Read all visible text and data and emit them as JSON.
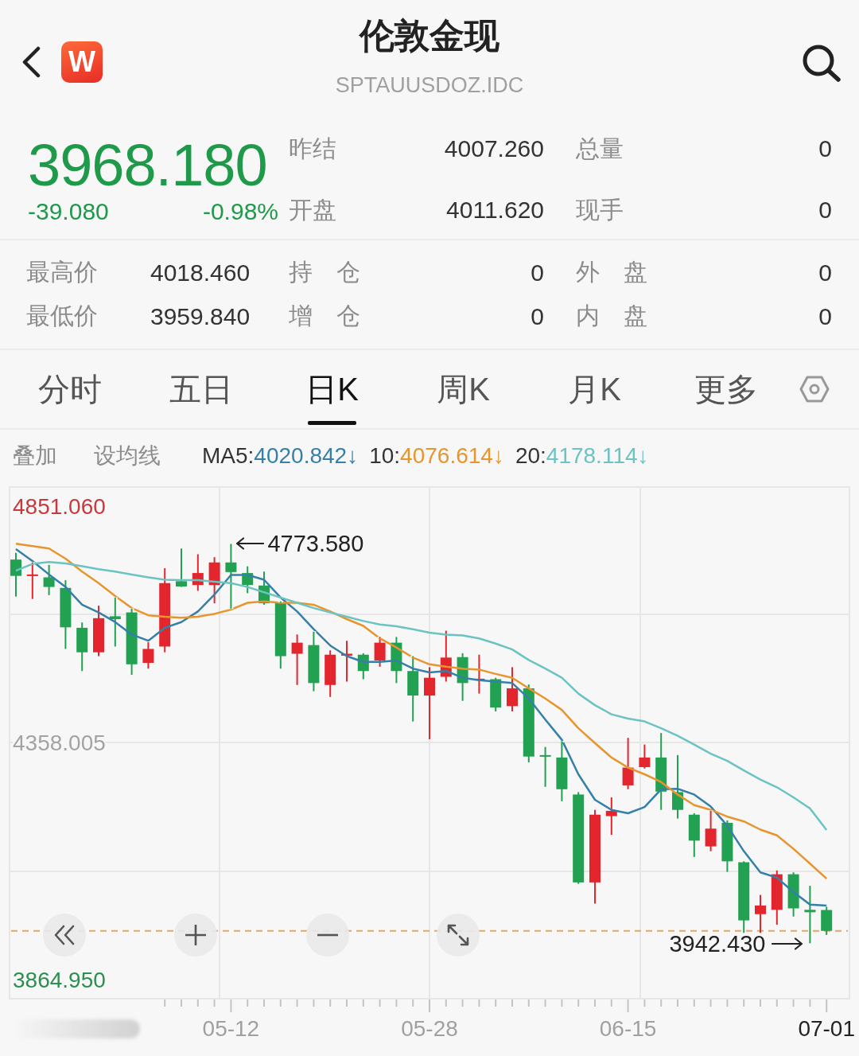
{
  "header": {
    "logo_text": "W",
    "title": "伦敦金现",
    "subtitle": "SPTAUUSDOZ.IDC"
  },
  "quote": {
    "price": "3968.180",
    "change": "-39.080",
    "change_percent": "-0.98%",
    "falling": true,
    "fields": [
      {
        "label": "昨结",
        "value": "4007.260"
      },
      {
        "label": "总量",
        "value": "0"
      },
      {
        "label": "开盘",
        "value": "4011.620"
      },
      {
        "label": "现手",
        "value": "0"
      }
    ]
  },
  "stats": [
    {
      "label": "最高价",
      "value": "4018.460"
    },
    {
      "label": "持　仓",
      "value": "0"
    },
    {
      "label": "外　盘",
      "value": "0"
    },
    {
      "label": "最低价",
      "value": "3959.840"
    },
    {
      "label": "增　仓",
      "value": "0"
    },
    {
      "label": "内　盘",
      "value": "0"
    }
  ],
  "tabs": [
    {
      "label": "分时",
      "selected": false
    },
    {
      "label": "五日",
      "selected": false
    },
    {
      "label": "日K",
      "selected": true
    },
    {
      "label": "周K",
      "selected": false
    },
    {
      "label": "月K",
      "selected": false
    },
    {
      "label": "更多",
      "selected": false
    }
  ],
  "indicator_bar": {
    "buttons": [
      "叠加",
      "设均线"
    ],
    "moving_averages": [
      {
        "value": "4020.842↓"
      },
      {
        "value": "4076.614↓"
      },
      {
        "value": "4178.114↓"
      }
    ]
  },
  "chart": {
    "last_date_highlighted": true,
    "chart_data": {
      "type": "candlestick",
      "categories": [
        null,
        null,
        null,
        null,
        null,
        null,
        null,
        null,
        null,
        null,
        null,
        null,
        null,
        "05-12",
        null,
        null,
        null,
        null,
        null,
        null,
        null,
        null,
        null,
        null,
        null,
        "05-28",
        null,
        null,
        null,
        null,
        null,
        null,
        null,
        null,
        null,
        null,
        null,
        "06-15",
        null,
        null,
        null,
        null,
        null,
        null,
        null,
        null,
        null,
        null,
        null,
        "07-01"
      ],
      "ohlc": [
        [
          4741,
          4755,
          4664,
          4707
        ],
        [
          4707,
          4735,
          4659,
          4710
        ],
        [
          4704,
          4730,
          4667,
          4684
        ],
        [
          4682,
          4698,
          4555,
          4600
        ],
        [
          4599,
          4610,
          4509,
          4548
        ],
        [
          4548,
          4645,
          4540,
          4619
        ],
        [
          4623,
          4662,
          4560,
          4617
        ],
        [
          4631,
          4639,
          4501,
          4523
        ],
        [
          4526,
          4569,
          4514,
          4555
        ],
        [
          4560,
          4723,
          4548,
          4692
        ],
        [
          4696,
          4764,
          4684,
          4685
        ],
        [
          4688,
          4752,
          4676,
          4713
        ],
        [
          4688,
          4746,
          4650,
          4735
        ],
        [
          4735,
          4773.58,
          4639,
          4715
        ],
        [
          4713,
          4727,
          4671,
          4688
        ],
        [
          4687,
          4716,
          4647,
          4650
        ],
        [
          4651,
          4654,
          4514,
          4540
        ],
        [
          4545,
          4585,
          4480,
          4568
        ],
        [
          4563,
          4591,
          4467,
          4484
        ],
        [
          4480,
          4552,
          4455,
          4543
        ],
        [
          4541,
          4572,
          4487,
          4545
        ],
        [
          4543,
          4546,
          4492,
          4509
        ],
        [
          4531,
          4580,
          4518,
          4568
        ],
        [
          4568,
          4580,
          4484,
          4509
        ],
        [
          4509,
          4540,
          4404,
          4458
        ],
        [
          4458,
          4517,
          4367,
          4495
        ],
        [
          4497,
          4593,
          4487,
          4537
        ],
        [
          4538,
          4546,
          4447,
          4484
        ],
        [
          4490,
          4543,
          4462,
          4493
        ],
        [
          4492,
          4495,
          4425,
          4433
        ],
        [
          4436,
          4517,
          4425,
          4473
        ],
        [
          4473,
          4481,
          4319,
          4331
        ],
        [
          4334,
          4351,
          4268,
          4331
        ],
        [
          4329,
          4363,
          4238,
          4263
        ],
        [
          4252,
          4257,
          4066,
          4069
        ],
        [
          4069,
          4220,
          4025,
          4210
        ],
        [
          4207,
          4246,
          4168,
          4218
        ],
        [
          4271,
          4370,
          4263,
          4308
        ],
        [
          4309,
          4356,
          4306,
          4329
        ],
        [
          4329,
          4380,
          4220,
          4258
        ],
        [
          4257,
          4334,
          4202,
          4220
        ],
        [
          4210,
          4213,
          4122,
          4156
        ],
        [
          4144,
          4218,
          4134,
          4181
        ],
        [
          4193,
          4198,
          4091,
          4113
        ],
        [
          4111,
          4113,
          3964,
          3990
        ],
        [
          4003,
          4043,
          3964,
          4021
        ],
        [
          4012,
          4094,
          3981,
          4086
        ],
        [
          4086,
          4090,
          3998,
          4015
        ],
        [
          4012,
          4062,
          3942.43,
          4007
        ],
        [
          4011.62,
          4018.46,
          3959.84,
          3968.18
        ]
      ],
      "series": [
        {
          "name": "MA5:",
          "type": "line",
          "color": "#3480a8",
          "values": [
            4763,
            4738,
            4710,
            4684,
            4647,
            4631,
            4611,
            4585,
            4572,
            4599,
            4611,
            4633,
            4668,
            4709,
            4709,
            4699,
            4662,
            4633,
            4596,
            4562,
            4540,
            4528,
            4528,
            4531,
            4514,
            4506,
            4509,
            4495,
            4490,
            4487,
            4484,
            4452,
            4408,
            4366,
            4294,
            4241,
            4220,
            4213,
            4226,
            4263,
            4264,
            4252,
            4227,
            4187,
            4134,
            4090,
            4079,
            4049,
            4023,
            4021
          ]
        },
        {
          "name": "10:",
          "type": "line",
          "color": "#e8952e",
          "values": [
            4774,
            4769,
            4764,
            4743,
            4716,
            4692,
            4665,
            4640,
            4625,
            4622,
            4620,
            4622,
            4628,
            4637,
            4651,
            4654,
            4651,
            4651,
            4647,
            4633,
            4617,
            4603,
            4577,
            4558,
            4537,
            4523,
            4518,
            4514,
            4512,
            4503,
            4495,
            4473,
            4452,
            4428,
            4390,
            4359,
            4329,
            4308,
            4294,
            4278,
            4252,
            4230,
            4220,
            4206,
            4196,
            4179,
            4167,
            4139,
            4108,
            4077
          ]
        },
        {
          "name": "20:",
          "type": "line",
          "color": "#6cc3c3",
          "values": [
            4718,
            4732,
            4736,
            4733,
            4727,
            4721,
            4716,
            4710,
            4704,
            4699,
            4698,
            4698,
            4695,
            4692,
            4684,
            4673,
            4662,
            4651,
            4640,
            4631,
            4622,
            4613,
            4606,
            4602,
            4596,
            4589,
            4585,
            4583,
            4577,
            4566,
            4554,
            4532,
            4514,
            4495,
            4462,
            4438,
            4419,
            4410,
            4404,
            4390,
            4374,
            4356,
            4337,
            4322,
            4302,
            4283,
            4267,
            4246,
            4223,
            4178
          ]
        }
      ],
      "ylim": [
        3827,
        4892
      ],
      "yticks": [
        {
          "value": 4851.06,
          "label": "4851.060"
        },
        {
          "value": 4358.005,
          "label": "4358.005"
        },
        {
          "value": 3864.95,
          "label": "3864.950"
        }
      ],
      "ref_lines": [
        {
          "axis": "y",
          "value": 3968.18
        }
      ],
      "annotations": [
        "4773.580",
        "3942.430"
      ]
    }
  }
}
